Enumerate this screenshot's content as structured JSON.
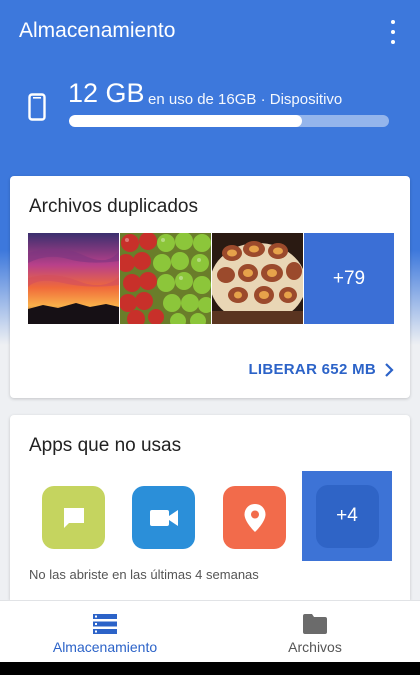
{
  "appbar": {
    "title": "Almacenamiento",
    "menu_icon": "more-vert-icon"
  },
  "storage": {
    "used": "12 GB",
    "description": "en uso de 16GB · Dispositivo",
    "used_fraction": 0.727,
    "icon": "phone-icon"
  },
  "duplicates": {
    "title": "Archivos duplicados",
    "thumbnails": [
      "sunset-photo",
      "apples-photo",
      "figs-tart-photo"
    ],
    "more_count": "+79",
    "action_label": "LIBERAR 652 MB"
  },
  "unused_apps": {
    "title": "Apps que no usas",
    "apps": [
      "messages-app-icon",
      "video-app-icon",
      "maps-app-icon"
    ],
    "more_count": "+4",
    "note": "No las abriste en las últimas 4 semanas"
  },
  "bottom_nav": {
    "items": [
      {
        "label": "Almacenamiento",
        "icon": "storage-icon",
        "active": true
      },
      {
        "label": "Archivos",
        "icon": "folder-icon",
        "active": false
      }
    ]
  },
  "colors": {
    "primary": "#3d78dc",
    "accent": "#2c63c8",
    "background": "#eef0f3"
  }
}
